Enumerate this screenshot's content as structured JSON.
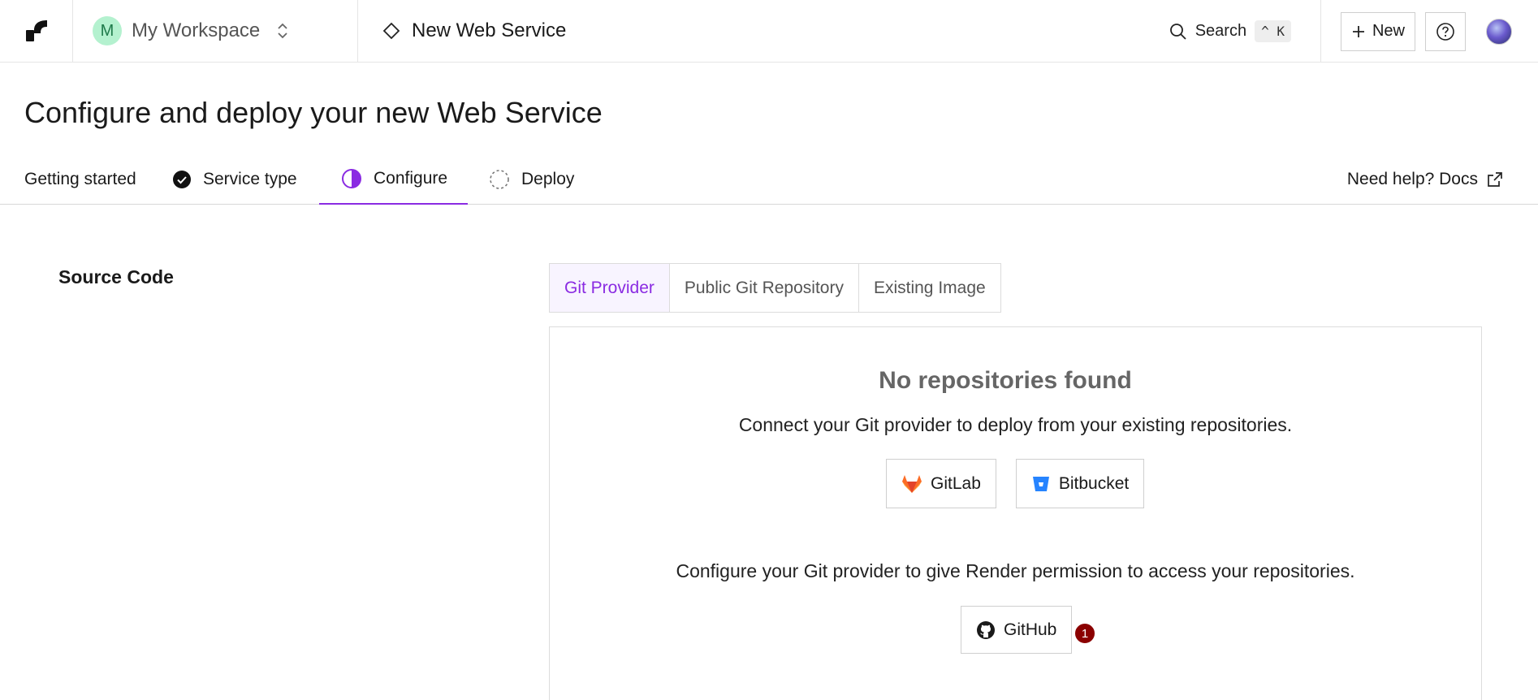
{
  "topbar": {
    "workspace_initial": "M",
    "workspace_name": "My Workspace",
    "page_name": "New Web Service",
    "search_label": "Search",
    "search_shortcut": "^ K",
    "new_label": "New"
  },
  "page": {
    "title": "Configure and deploy your new Web Service"
  },
  "steps": [
    {
      "label": "Getting started",
      "state": "done-plain"
    },
    {
      "label": "Service type",
      "state": "complete"
    },
    {
      "label": "Configure",
      "state": "active"
    },
    {
      "label": "Deploy",
      "state": "pending"
    }
  ],
  "docs_link": "Need help? Docs",
  "source": {
    "section_label": "Source Code",
    "tabs": [
      "Git Provider",
      "Public Git Repository",
      "Existing Image"
    ],
    "active_tab": "Git Provider",
    "empty_title": "No repositories found",
    "empty_subtitle": "Connect your Git provider to deploy from your existing repositories.",
    "providers": [
      "GitLab",
      "Bitbucket"
    ],
    "configure_text": "Configure your Git provider to give Render permission to access your repositories.",
    "github_label": "GitHub",
    "badge": "1"
  },
  "colors": {
    "accent": "#8a2be2",
    "workspace_avatar": "#b4f1cf",
    "badge": "#8b0000",
    "gitlab": "#fc6d26",
    "bitbucket": "#2684ff"
  }
}
